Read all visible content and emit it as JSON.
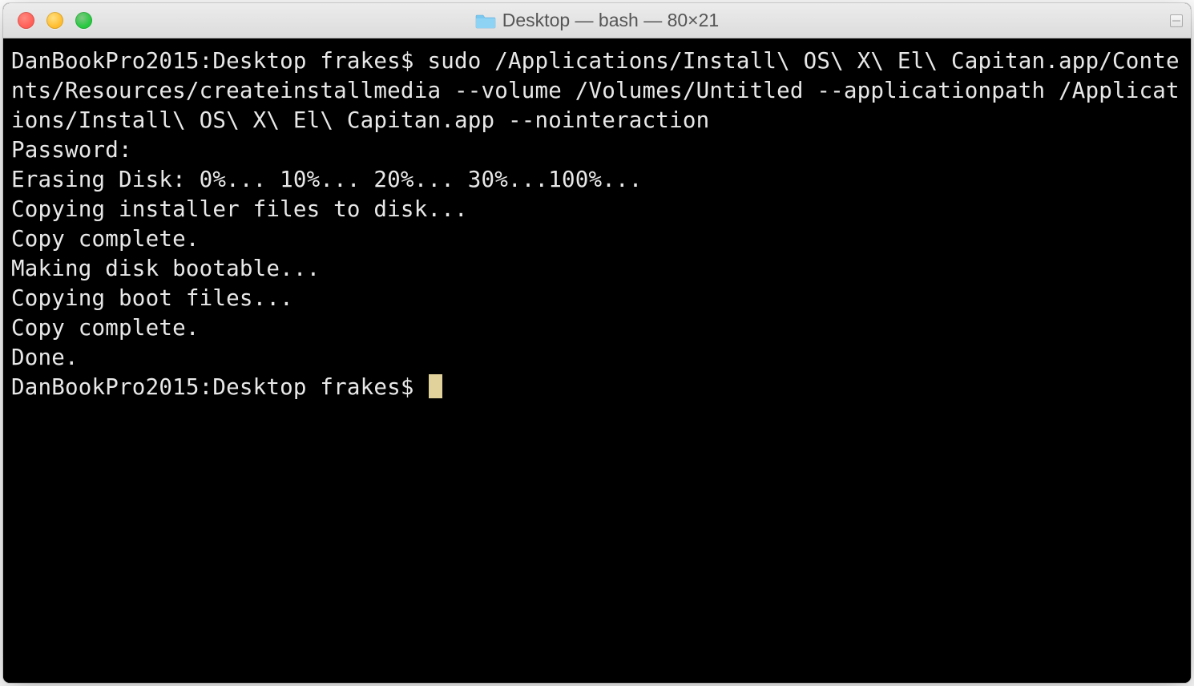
{
  "window": {
    "title": "Desktop — bash — 80×21"
  },
  "terminal": {
    "lines": [
      "DanBookPro2015:Desktop frakes$ sudo /Applications/Install\\ OS\\ X\\ El\\ Capitan.app/Contents/Resources/createinstallmedia --volume /Volumes/Untitled --applicationpath /Applications/Install\\ OS\\ X\\ El\\ Capitan.app --nointeraction",
      "Password:",
      "Erasing Disk: 0%... 10%... 20%... 30%...100%...",
      "Copying installer files to disk...",
      "Copy complete.",
      "Making disk bootable...",
      "Copying boot files...",
      "Copy complete.",
      "Done."
    ],
    "prompt": "DanBookPro2015:Desktop frakes$ "
  }
}
